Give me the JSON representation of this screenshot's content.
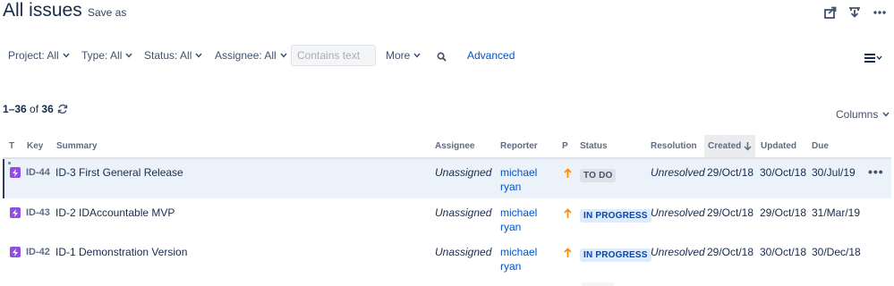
{
  "header": {
    "title": "All issues",
    "save_as": "Save as",
    "icons": [
      "share-icon",
      "export-icon",
      "more-icon"
    ]
  },
  "filters": {
    "project": "Project: All",
    "type": "Type: All",
    "status": "Status: All",
    "assignee": "Assignee: All",
    "search_placeholder": "Contains text",
    "more": "More",
    "advanced": "Advanced"
  },
  "results": {
    "range": "1–36",
    "of": "of",
    "total": "36",
    "columns_label": "Columns"
  },
  "table": {
    "columns": {
      "type": "T",
      "key": "Key",
      "summary": "Summary",
      "assignee": "Assignee",
      "reporter": "Reporter",
      "priority": "P",
      "status": "Status",
      "resolution": "Resolution",
      "created": "Created",
      "updated": "Updated",
      "due": "Due"
    },
    "sorted_by": "Created",
    "rows": [
      {
        "key": "ID-44",
        "summary": "ID-3 First General Release",
        "assignee": "Unassigned",
        "reporter_first": "michael",
        "reporter_last": "ryan",
        "status": "TO DO",
        "resolution": "Unresolved",
        "created": "29/Oct/18",
        "updated": "30/Oct/18",
        "due": "30/Jul/19",
        "actions": "•••"
      },
      {
        "key": "ID-43",
        "summary": "ID-2 IDAccountable MVP",
        "assignee": "Unassigned",
        "reporter_first": "michael",
        "reporter_last": "ryan",
        "status": "IN PROGRESS",
        "resolution": "Unresolved",
        "created": "29/Oct/18",
        "updated": "29/Oct/18",
        "due": "31/Mar/19"
      },
      {
        "key": "ID-42",
        "summary": "ID-1 Demonstration Version",
        "assignee": "Unassigned",
        "reporter_first": "michael",
        "reporter_last": "ryan",
        "status": "IN PROGRESS",
        "resolution": "Unresolved",
        "created": "29/Oct/18",
        "updated": "30/Oct/18",
        "due": "30/Dec/18"
      }
    ]
  },
  "colors": {
    "link": "#0052cc",
    "priority_arrow": "#ff8b00",
    "issue_type": "#904ee2",
    "row_selected": "#ebf2f9"
  }
}
